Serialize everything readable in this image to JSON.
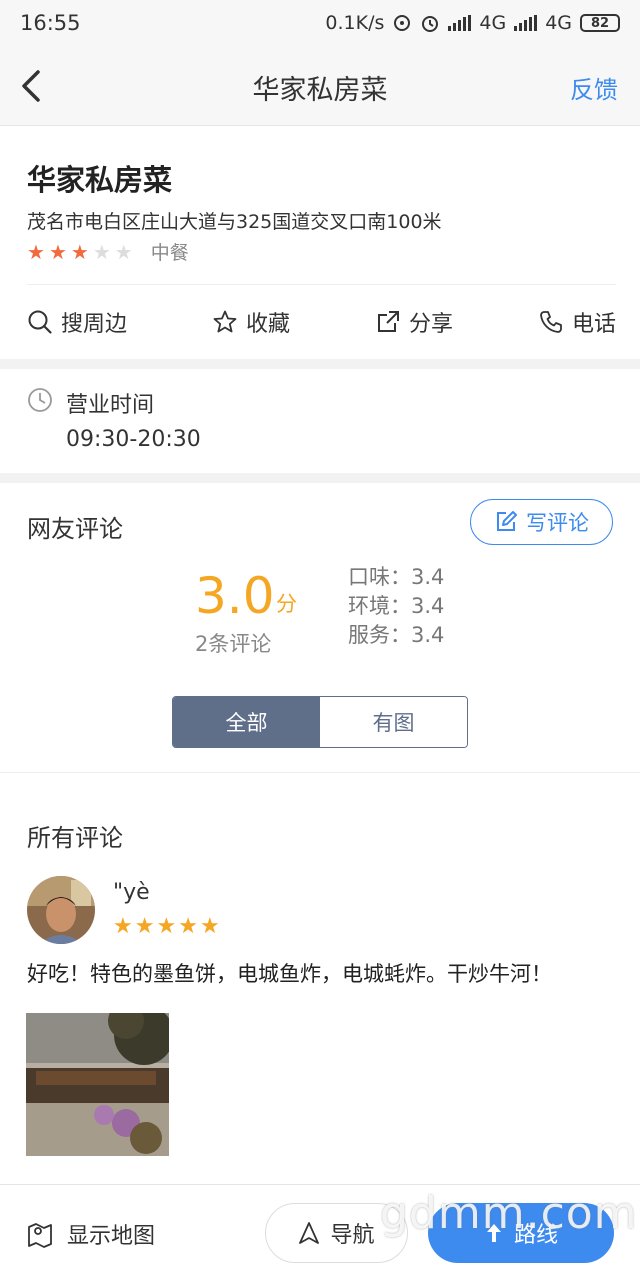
{
  "status_bar": {
    "time": "16:55",
    "speed": "0.1K/s",
    "network1": "4G",
    "network2": "4G",
    "battery": "82"
  },
  "nav": {
    "title": "华家私房菜",
    "feedback": "反馈"
  },
  "shop": {
    "name": "华家私房菜",
    "address": "茂名市电白区庄山大道与325国道交叉口南100米",
    "rating_stars": 3,
    "rating_max": 5,
    "cuisine": "中餐",
    "star_color": "#f26a3d"
  },
  "actions": [
    {
      "label": "搜周边",
      "icon": "search-icon"
    },
    {
      "label": "收藏",
      "icon": "star-outline-icon"
    },
    {
      "label": "分享",
      "icon": "share-icon"
    },
    {
      "label": "电话",
      "icon": "phone-icon"
    }
  ],
  "hours": {
    "title": "营业时间",
    "value": "09:30-20:30"
  },
  "reviews": {
    "title": "网友评论",
    "write_label": "写评论",
    "score": "3.0",
    "score_unit": "分",
    "count": "2条评论",
    "taste": "口味：3.4",
    "environment": "环境：3.4",
    "service": "服务：3.4",
    "tab_all": "全部",
    "tab_photos": "有图"
  },
  "all_reviews": {
    "title": "所有评论",
    "items": [
      {
        "user": "\"yè",
        "stars": 5,
        "text": "好吃！特色的墨鱼饼，电城鱼炸，电城蚝炸。干炒牛河！"
      }
    ]
  },
  "bottom": {
    "show_map": "显示地图",
    "navigate": "导航",
    "route": "路线",
    "accent": "#3d8bef"
  },
  "watermark": "gdmm.com"
}
